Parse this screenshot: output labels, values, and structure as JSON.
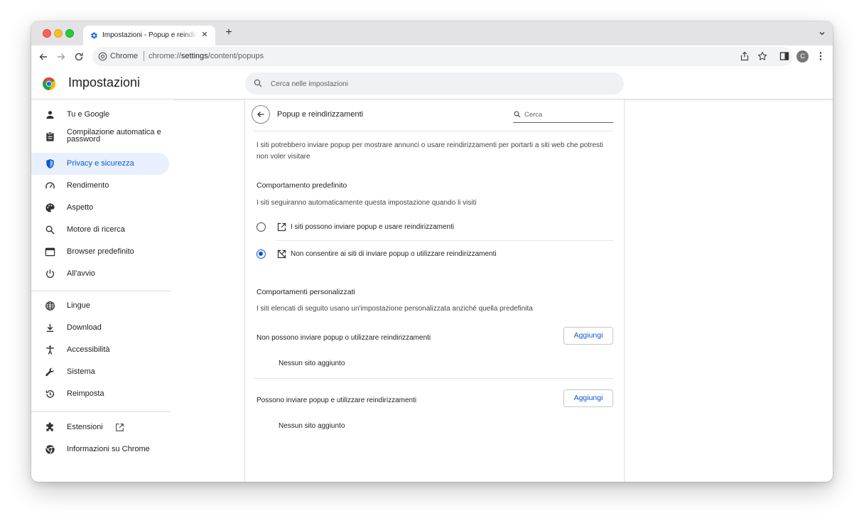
{
  "browser": {
    "tab_title": "Impostazioni - Popup e reindirizzamenti",
    "tab_close": "✕",
    "new_tab": "+",
    "omnibox_site": "Chrome",
    "url_prefix": "chrome://",
    "url_host": "settings",
    "url_path": "/content/popups",
    "avatar_letter": "C"
  },
  "header": {
    "title": "Impostazioni",
    "search_placeholder": "Cerca nelle impostazioni"
  },
  "sidebar": {
    "items": [
      {
        "label": "Tu e Google",
        "icon": "person-icon"
      },
      {
        "label": "Compilazione automatica e password",
        "icon": "clipboard-icon"
      },
      {
        "label": "Privacy e sicurezza",
        "icon": "shield-icon",
        "active": true
      },
      {
        "label": "Rendimento",
        "icon": "speedometer-icon"
      },
      {
        "label": "Aspetto",
        "icon": "palette-icon"
      },
      {
        "label": "Motore di ricerca",
        "icon": "search-icon"
      },
      {
        "label": "Browser predefinito",
        "icon": "browser-window-icon"
      },
      {
        "label": "All'avvio",
        "icon": "power-icon"
      },
      {
        "label": "Lingue",
        "icon": "globe-icon"
      },
      {
        "label": "Download",
        "icon": "download-icon"
      },
      {
        "label": "Accessibilità",
        "icon": "accessibility-icon"
      },
      {
        "label": "Sistema",
        "icon": "wrench-icon"
      },
      {
        "label": "Reimposta",
        "icon": "history-icon"
      },
      {
        "label": "Estensioni",
        "icon": "puzzle-icon"
      },
      {
        "label": "Informazioni su Chrome",
        "icon": "chrome-icon"
      }
    ]
  },
  "main": {
    "page_title": "Popup e reindirizzamenti",
    "search_placeholder": "Cerca",
    "description": "I siti potrebbero inviare popup per mostrare annunci o usare reindirizzamenti per portarti a siti web che potresti non voler visitare",
    "default_heading": "Comportamento predefinito",
    "default_subtext": "I siti seguiranno automaticamente questa impostazione quando li visiti",
    "options": [
      {
        "label": "I siti possono inviare popup e usare reindirizzamenti",
        "checked": false
      },
      {
        "label": "Non consentire ai siti di inviare popup o utilizzare reindirizzamenti",
        "checked": true
      }
    ],
    "custom_heading": "Comportamenti personalizzati",
    "custom_subtext": "I siti elencati di seguito usano un'impostazione personalizzata anziché quella predefinita",
    "blocked_label": "Non possono inviare popup o utilizzare reindirizzamenti",
    "blocked_add": "Aggiungi",
    "blocked_empty": "Nessun sito aggiunto",
    "allowed_label": "Possono inviare popup e utilizzare reindirizzamenti",
    "allowed_add": "Aggiungi",
    "allowed_empty": "Nessun sito aggiunto"
  },
  "colors": {
    "accent": "#0b57d0",
    "active_nav_bg": "#e8f0fe",
    "tabstrip_bg": "#e3e3e6"
  }
}
